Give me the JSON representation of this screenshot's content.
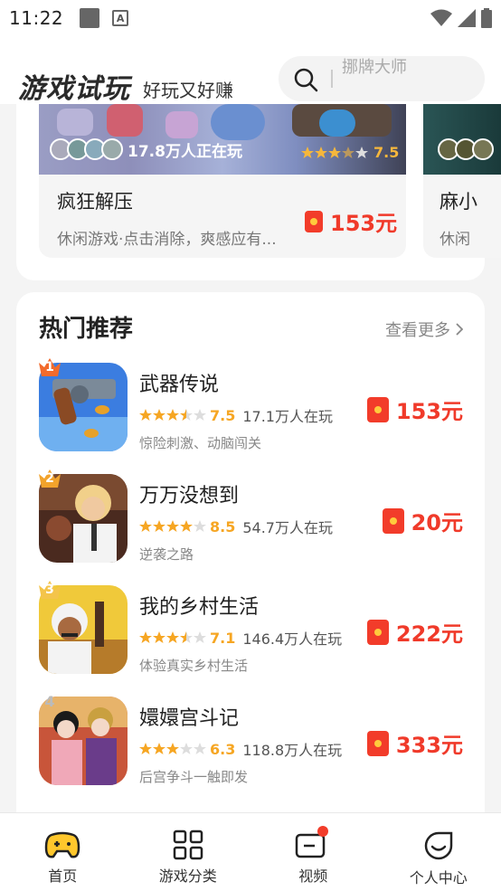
{
  "status_bar": {
    "time": "11:22"
  },
  "header": {
    "title": "游戏试玩",
    "subtitle": "好玩又好赚",
    "search_placeholder": "挪牌大师"
  },
  "featured": [
    {
      "title": "疯狂解压",
      "playing": "17.8万人正在玩",
      "rating": "7.5",
      "desc": "休闲游戏·点击消除，爽感应有...",
      "price": "153元"
    },
    {
      "title": "麻小",
      "desc": "休闲"
    }
  ],
  "hot": {
    "title": "热门推荐",
    "more": "查看更多",
    "games": [
      {
        "rank": "1",
        "name": "武器传说",
        "rating": "7.5",
        "stars": 3.5,
        "players": "17.1万人在玩",
        "desc": "惊险刺激、动脑闯关",
        "price": "153元"
      },
      {
        "rank": "2",
        "name": "万万没想到",
        "rating": "8.5",
        "stars": 4,
        "players": "54.7万人在玩",
        "desc": "逆袭之路",
        "price": "20元"
      },
      {
        "rank": "3",
        "name": "我的乡村生活",
        "rating": "7.1",
        "stars": 3.5,
        "players": "146.4万人在玩",
        "desc": "体验真实乡村生活",
        "price": "222元"
      },
      {
        "rank": "4",
        "name": "嬛嬛宫斗记",
        "rating": "6.3",
        "stars": 3,
        "players": "118.8万人在玩",
        "desc": "后宫争斗一触即发",
        "price": "333元"
      }
    ]
  },
  "tabs": [
    {
      "label": "首页",
      "icon": "gamepad-icon"
    },
    {
      "label": "游戏分类",
      "icon": "grid-icon"
    },
    {
      "label": "视频",
      "icon": "video-icon"
    },
    {
      "label": "个人中心",
      "icon": "smile-icon"
    }
  ],
  "colors": {
    "accent": "#f03a2a",
    "star": "#f6a623"
  }
}
